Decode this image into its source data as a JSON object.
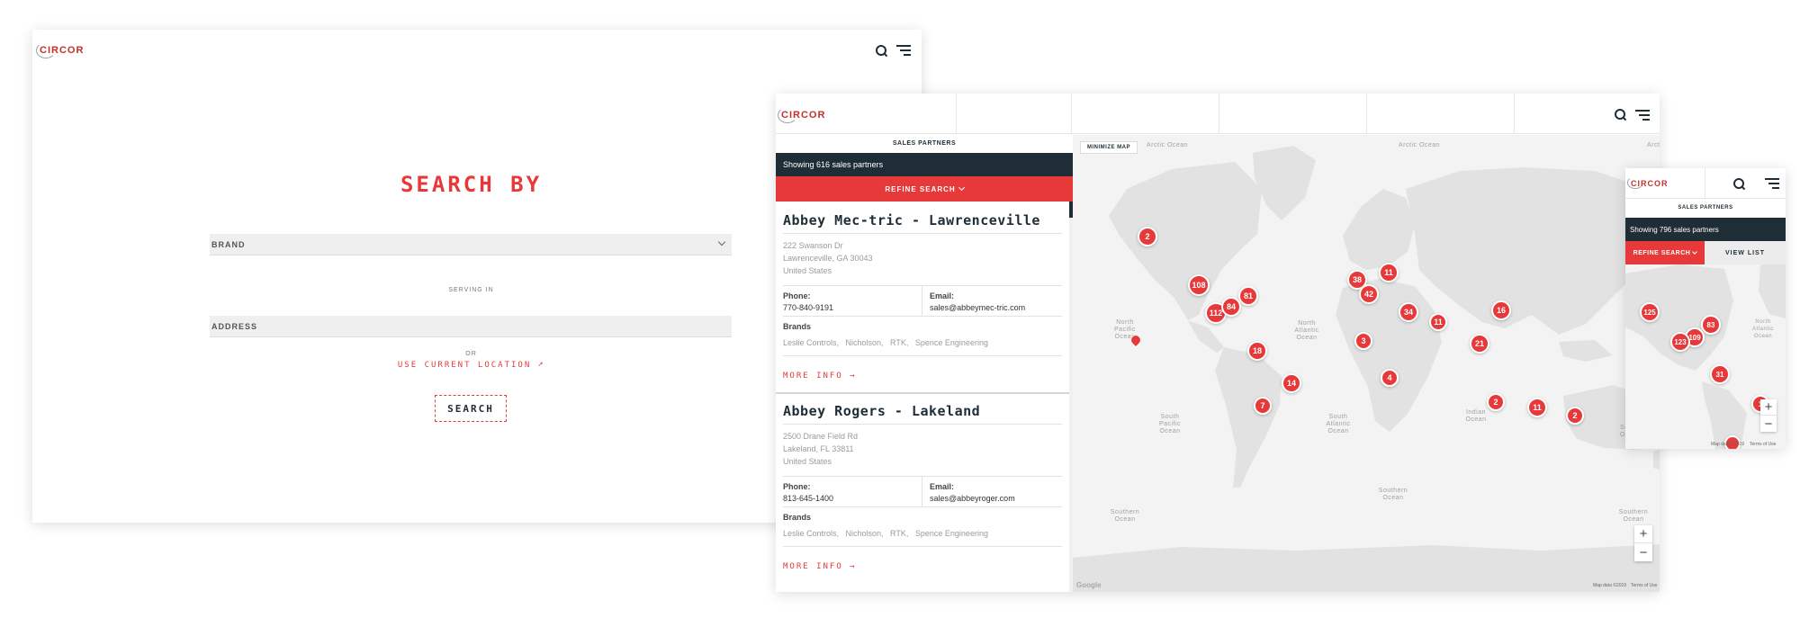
{
  "colors": {
    "accent": "#e8393a",
    "dark": "#1f2d36",
    "panel_bg": "#ffffff",
    "map_land": "#e3e3e3",
    "map_water": "#f3f3f3"
  },
  "brand": {
    "logo_text": "CIRCOR"
  },
  "search_page": {
    "title": "SEARCH BY",
    "brand_placeholder": "BRAND",
    "serving_in": "SERVING IN",
    "address_placeholder": "ADDRESS",
    "or": "OR",
    "use_location": "USE CURRENT LOCATION",
    "search_button": "SEARCH"
  },
  "desktop_map": {
    "section_label": "SALES PARTNERS",
    "showing": "Showing 616 sales partners",
    "refine": "REFINE SEARCH",
    "minimize_map": "MINIMIZE MAP",
    "partners": [
      {
        "name": "Abbey Mec-tric - Lawrenceville",
        "address1": "222 Swanson Dr",
        "address2": "Lawrenceville, GA 30043",
        "country": "United States",
        "phone_label": "Phone:",
        "phone": "770-840-9191",
        "email_label": "Email:",
        "email": "sales@abbeymec-tric.com",
        "brands_label": "Brands",
        "brands": "Leslie Controls,   Nicholson,   RTK,   Spence Engineering",
        "more": "MORE INFO"
      },
      {
        "name": "Abbey Rogers - Lakeland",
        "address1": "2500 Drane Field Rd",
        "address2": "Lakeland, FL 33811",
        "country": "United States",
        "phone_label": "Phone:",
        "phone": "813-645-1400",
        "email_label": "Email:",
        "email": "sales@abbeyroger.com",
        "brands_label": "Brands",
        "brands": "Leslie Controls,   Nicholson,   RTK,   Spence Engineering",
        "more": "MORE INFO"
      }
    ],
    "oceans": {
      "arctic1": "Arctic Ocean",
      "arctic2": "Arctic Ocean",
      "arctic3": "Arct",
      "north_pacific": "North Pacific Ocean",
      "north_atlantic": "North Atlantic Ocean",
      "south_pacific": "South Pacific Ocean",
      "south_atlantic": "South Atlantic Ocean",
      "indian": "Indian Ocean",
      "southern1": "Southern Ocean",
      "southern2": "Southern Ocean",
      "southern3": "Southern Ocean",
      "south_edge": "Sou Oce"
    },
    "clusters": [
      "2",
      "108",
      "81",
      "112",
      "84",
      "18",
      "14",
      "7",
      "38",
      "11",
      "42",
      "34",
      "11",
      "3",
      "4",
      "16",
      "21",
      "2",
      "11",
      "2"
    ],
    "attribution": {
      "google": "Google",
      "map_data": "Map data ©2019",
      "terms": "Terms of Use"
    }
  },
  "mobile_map": {
    "section_label": "SALES PARTNERS",
    "showing": "Showing 796 sales partners",
    "refine": "REFINE SEARCH",
    "view_list": "VIEW LIST",
    "clusters": [
      "125",
      "83",
      "109",
      "123",
      "31",
      "1"
    ],
    "ocean": "North Atlantic Ocean",
    "attribution": {
      "map_data": "Map data ©2019",
      "terms": "Terms of Use"
    }
  }
}
